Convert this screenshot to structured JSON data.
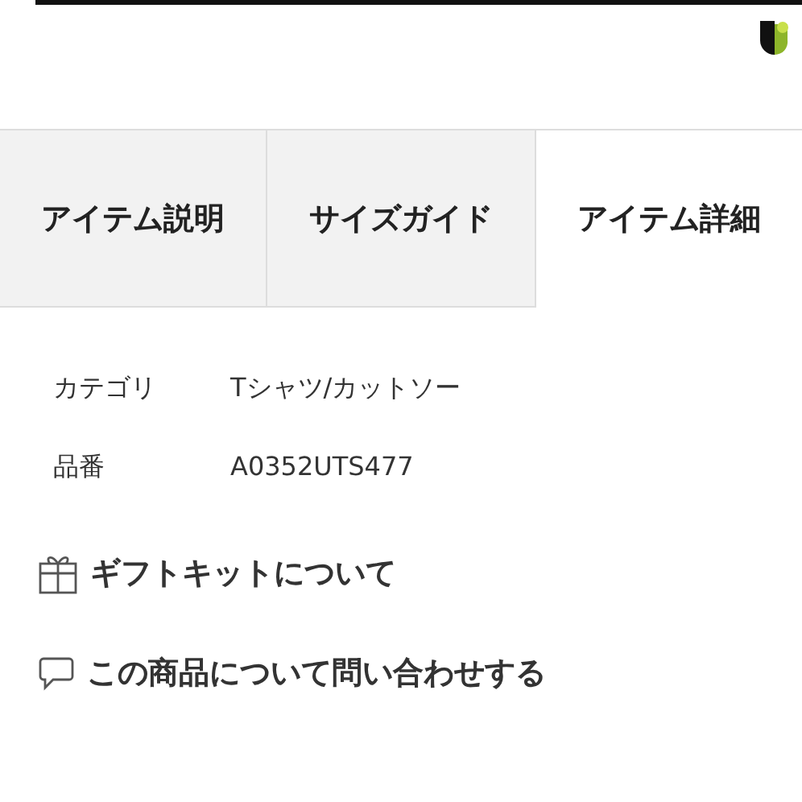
{
  "tabs": [
    {
      "label": "アイテム説明",
      "selected": false
    },
    {
      "label": "サイズガイド",
      "selected": false
    },
    {
      "label": "アイテム詳細",
      "selected": true
    }
  ],
  "details": [
    {
      "label": "カテゴリ",
      "value": "Tシャツ/カットソー"
    },
    {
      "label": "品番",
      "value": "A0352UTS477"
    }
  ],
  "links": [
    {
      "kind": "gift",
      "label": "ギフトキットについて"
    },
    {
      "kind": "contact",
      "label": "この商品について問い合わせする"
    }
  ]
}
